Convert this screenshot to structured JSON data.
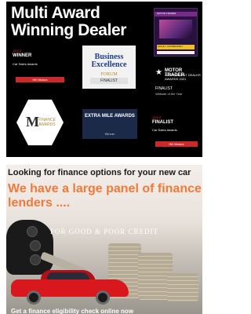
{
  "awards_banner": {
    "title_line1": "Multi Award",
    "title_line2": "Winning Dealer",
    "cards": {
      "magazine": {
        "heading": "MOTOR TRADER",
        "footer": "HIGHLY COMMENDED"
      },
      "winner": {
        "year": "2023",
        "status": "WINNER",
        "category": "Car Sales Awards",
        "button": "Hill Motors"
      },
      "business_excellence": {
        "name": "Business Excellence",
        "sub": "FORUM",
        "status": "FINALIST"
      },
      "motor_trader": {
        "brand": "MOTOR TRADER",
        "award": "INDEPENDENT DEALER AWARDS 2021",
        "status": "FINALIST",
        "category": "Website of the Year"
      },
      "finance_awards": {
        "letter": "M",
        "label": "FINANCE AWARDS"
      },
      "extra_mile": {
        "label": "EXTRA MILE AWARDS",
        "status": "Winner"
      },
      "finalist": {
        "year": "2023",
        "status": "FINALIST",
        "category": "Car Sales Awards",
        "button": "Hill Motors"
      }
    }
  },
  "finance_banner": {
    "heading": "Looking for finance options for your new car",
    "subheading": "We have a large panel of finance lenders ....",
    "tagline": "FOR GOOD & POOR CREDIT",
    "footer": "Get a finance eligibility check online now"
  },
  "colors": {
    "awards_bg": "#000000",
    "accent_red": "#cc2a2a",
    "finance_orange": "#f07a3a",
    "car_red": "#d9181e"
  }
}
